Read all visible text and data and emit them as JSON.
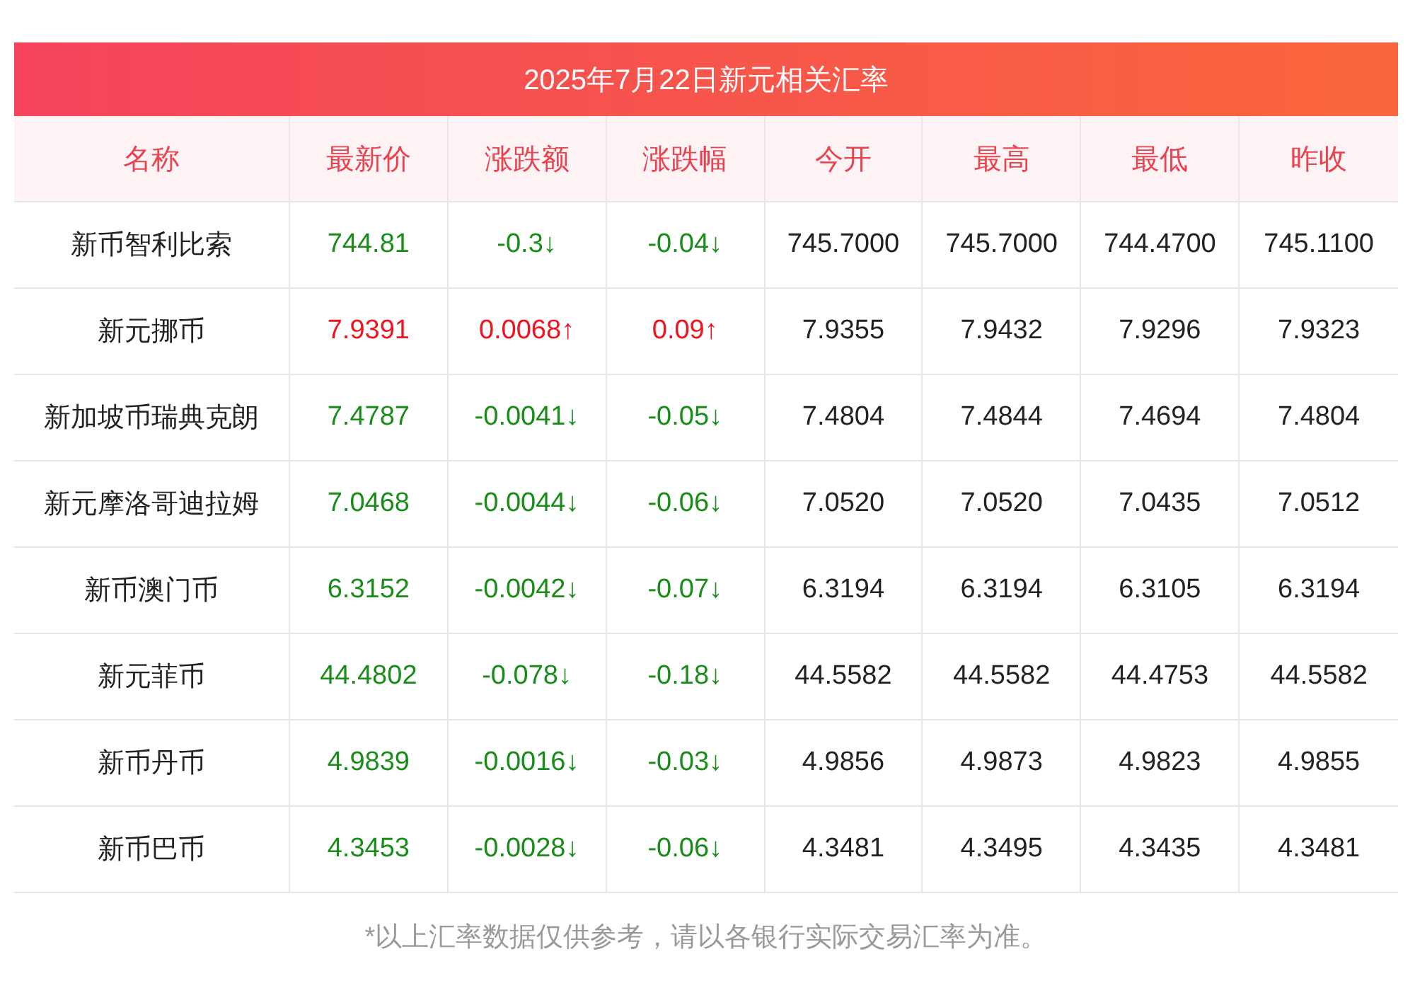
{
  "title": "2025年7月22日新元相关汇率",
  "columns": [
    "名称",
    "最新价",
    "涨跌额",
    "涨跌幅",
    "今开",
    "最高",
    "最低",
    "昨收"
  ],
  "rows": [
    {
      "name": "新币智利比索",
      "color": "#1a8c1a",
      "price": "744.81",
      "change": "-0.3↓",
      "pct": "-0.04↓",
      "open": "745.7000",
      "high": "745.7000",
      "low": "744.4700",
      "prev": "745.1100"
    },
    {
      "name": "新元挪币",
      "color": "#f0141e",
      "price": "7.9391",
      "change": "0.0068↑",
      "pct": "0.09↑",
      "open": "7.9355",
      "high": "7.9432",
      "low": "7.9296",
      "prev": "7.9323"
    },
    {
      "name": "新加坡币瑞典克朗",
      "color": "#1a8c1a",
      "price": "7.4787",
      "change": "-0.0041↓",
      "pct": "-0.05↓",
      "open": "7.4804",
      "high": "7.4844",
      "low": "7.4694",
      "prev": "7.4804"
    },
    {
      "name": "新元摩洛哥迪拉姆",
      "color": "#1a8c1a",
      "price": "7.0468",
      "change": "-0.0044↓",
      "pct": "-0.06↓",
      "open": "7.0520",
      "high": "7.0520",
      "low": "7.0435",
      "prev": "7.0512"
    },
    {
      "name": "新币澳门币",
      "color": "#1a8c1a",
      "price": "6.3152",
      "change": "-0.0042↓",
      "pct": "-0.07↓",
      "open": "6.3194",
      "high": "6.3194",
      "low": "6.3105",
      "prev": "6.3194"
    },
    {
      "name": "新元菲币",
      "color": "#1a8c1a",
      "price": "44.4802",
      "change": "-0.078↓",
      "pct": "-0.18↓",
      "open": "44.5582",
      "high": "44.5582",
      "low": "44.4753",
      "prev": "44.5582"
    },
    {
      "name": "新币丹币",
      "color": "#1a8c1a",
      "price": "4.9839",
      "change": "-0.0016↓",
      "pct": "-0.03↓",
      "open": "4.9856",
      "high": "4.9873",
      "low": "4.9823",
      "prev": "4.9855"
    },
    {
      "name": "新币巴币",
      "color": "#1a8c1a",
      "price": "4.3453",
      "change": "-0.0028↓",
      "pct": "-0.06↓",
      "open": "4.3481",
      "high": "4.3495",
      "low": "4.3435",
      "prev": "4.3481"
    }
  ],
  "footnote": "*以上汇率数据仅供参考，请以各银行实际交易汇率为准。"
}
